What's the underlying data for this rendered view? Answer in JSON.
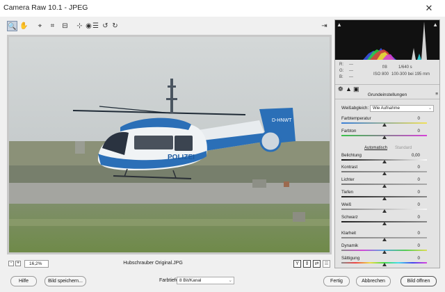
{
  "window": {
    "title": "Camera Raw 10.1 - JPEG",
    "close_glyph": "✕"
  },
  "toolbar": {
    "tools": [
      {
        "name": "zoom-tool-icon",
        "glyph": "🔍",
        "active": true
      },
      {
        "name": "hand-tool-icon",
        "glyph": "✋",
        "active": false
      },
      {
        "name": "eyedropper-icon",
        "glyph": "⌖",
        "active": false
      },
      {
        "name": "crop-icon",
        "glyph": "⌗",
        "active": false
      },
      {
        "name": "straighten-icon",
        "glyph": "⊟",
        "active": false
      },
      {
        "name": "spot-removal-icon",
        "glyph": "⊹",
        "active": false
      },
      {
        "name": "red-eye-icon",
        "glyph": "◉",
        "active": false
      },
      {
        "name": "list-icon",
        "glyph": "☰",
        "active": false
      },
      {
        "name": "rotate-left-icon",
        "glyph": "↺",
        "active": false
      },
      {
        "name": "rotate-right-icon",
        "glyph": "↻",
        "active": false
      }
    ],
    "fullscreen_glyph": "⇥"
  },
  "photo": {
    "helicopter_text": "POLIZEI",
    "tail_registration": "D-HNWT"
  },
  "status": {
    "zoom_minus": "-",
    "zoom_plus": "+",
    "zoom": "16,2%",
    "filename": "Hubschrauber Original.JPG",
    "view_y": "Y",
    "view_toggle": "⇕",
    "view_swap": "⇄",
    "view_settings": "☰"
  },
  "histogram": {
    "colors": {
      "red": "#e23b3b",
      "green": "#2fd23f",
      "blue": "#3a58f0",
      "yellow": "#e6e63a",
      "cyan": "#33dfe8",
      "magenta": "#d23ad8",
      "white": "#f4f4f4"
    }
  },
  "info": {
    "r_label": "R:",
    "r_value": "---",
    "g_label": "G:",
    "g_value": "---",
    "b_label": "B:",
    "b_value": "---",
    "aperture": "f/8",
    "shutter": "1/640 s",
    "iso": "ISO 800",
    "lens": "100-300 bei 195 mm"
  },
  "panel": {
    "section_title": "Grundeinstellungen",
    "menu_glyph": "≡",
    "wb_label": "Weißabgleich:",
    "wb_value": "Wie Aufnahme",
    "auto_label": "Automatisch",
    "default_label": "Standard",
    "sliders": [
      {
        "label": "Farbtemperatur",
        "value": "0",
        "pos": 0.5
      },
      {
        "label": "Farbton",
        "value": "0",
        "pos": 0.5
      },
      {
        "label": "Belichtung",
        "value": "0,00",
        "pos": 0.5
      },
      {
        "label": "Kontrast",
        "value": "0",
        "pos": 0.5
      },
      {
        "label": "Lichter",
        "value": "0",
        "pos": 0.5
      },
      {
        "label": "Tiefen",
        "value": "0",
        "pos": 0.5
      },
      {
        "label": "Weiß",
        "value": "0",
        "pos": 0.5
      },
      {
        "label": "Schwarz",
        "value": "0",
        "pos": 0.5
      },
      {
        "label": "Klarheit",
        "value": "0",
        "pos": 0.5
      },
      {
        "label": "Dynamik",
        "value": "0",
        "pos": 0.5
      },
      {
        "label": "Sättigung",
        "value": "0",
        "pos": 0.5
      }
    ]
  },
  "bottom": {
    "help": "Hilfe",
    "save_image": "Bild speichern...",
    "depth_label": "Farbtiefe:",
    "depth_value": "8 Bit/Kanal",
    "done": "Fertig",
    "cancel": "Abbrechen",
    "open_image": "Bild öffnen"
  }
}
